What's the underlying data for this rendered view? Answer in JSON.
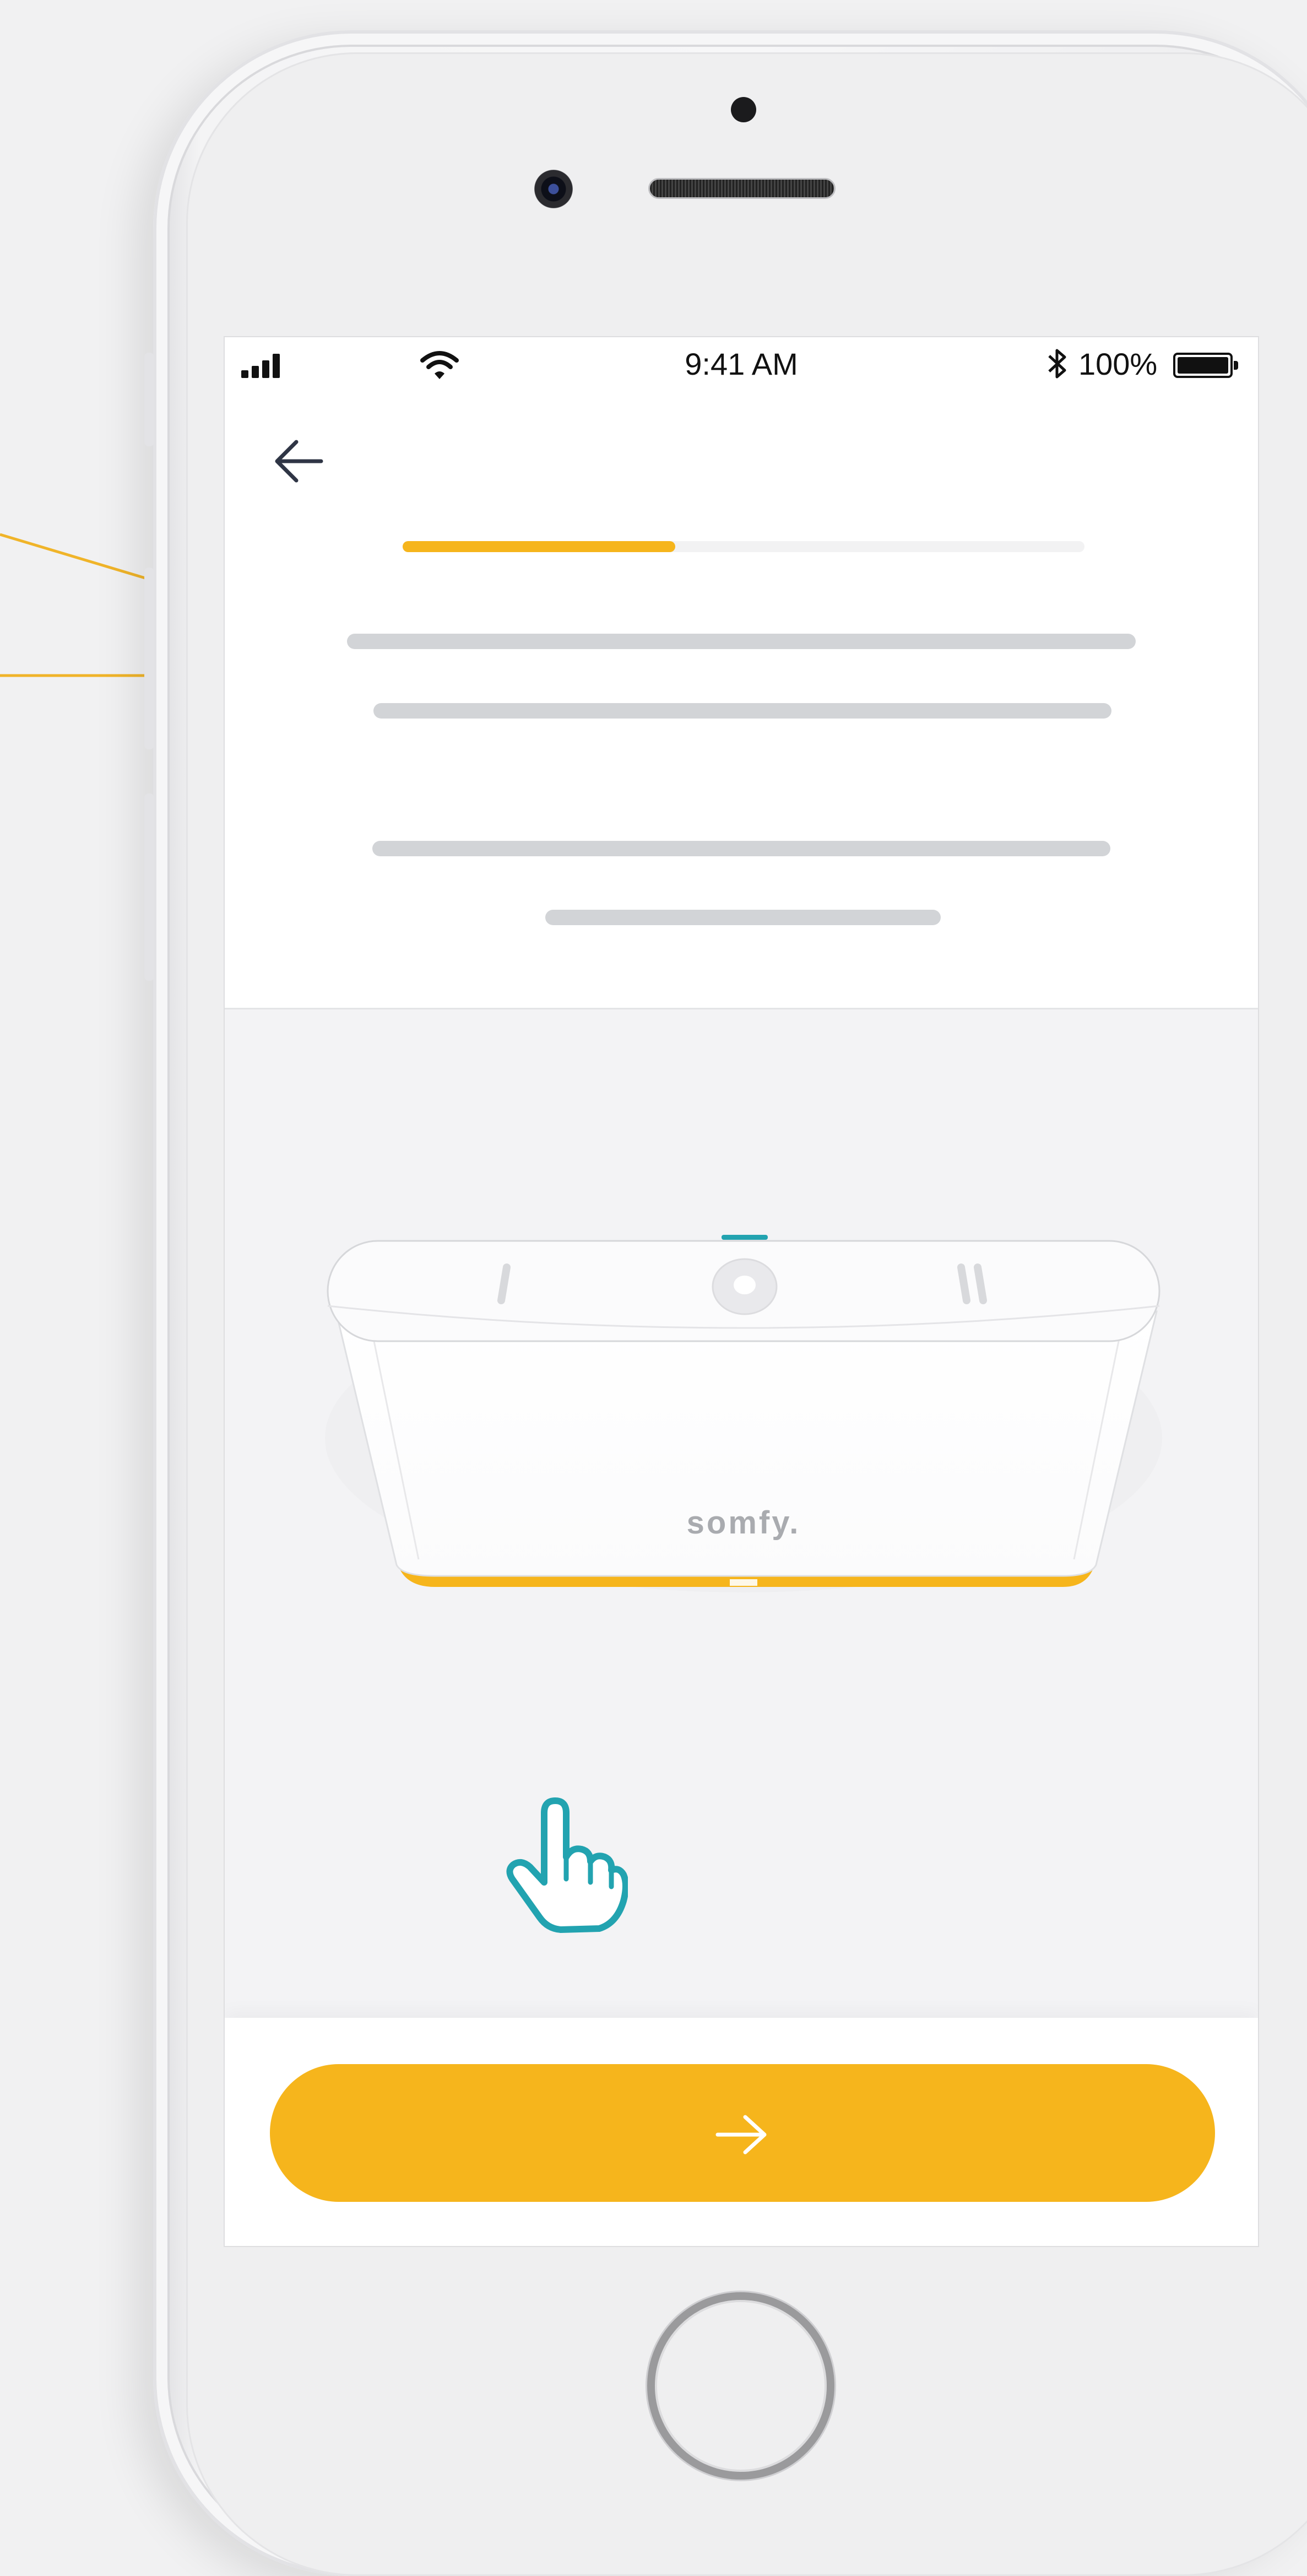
{
  "status_bar": {
    "time": "9:41 AM",
    "battery_percent": "100%",
    "signal_icon": "signal-bars-icon",
    "wifi_icon": "wifi-icon",
    "bluetooth_icon": "bluetooth-icon",
    "battery_icon": "battery-full-icon"
  },
  "nav": {
    "back_icon": "arrow-left-icon"
  },
  "progress": {
    "fraction": 0.4
  },
  "device": {
    "brand": "somfy."
  },
  "footer": {
    "next_icon": "arrow-right-icon",
    "tap_icon": "hand-pointer-icon"
  },
  "colors": {
    "accent": "#f6b51c",
    "teal": "#22a3b0",
    "placeholder": "#d2d4d7",
    "background": "#f3f3f5"
  }
}
